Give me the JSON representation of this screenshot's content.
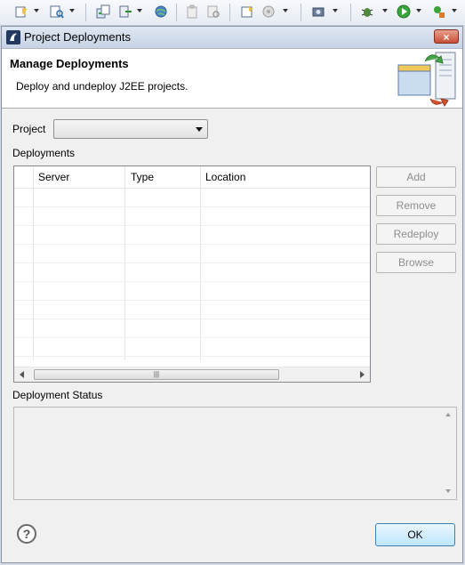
{
  "toolbar": {
    "icons": [
      "new-wizard-icon",
      "search-icon",
      "deploy-icon",
      "run-server-icon",
      "globe-icon",
      "clipboard-icon",
      "refresh-icon",
      "new-file-icon",
      "web-service-icon",
      "camera-icon",
      "debug-icon",
      "run-icon",
      "external-tools-icon"
    ]
  },
  "window": {
    "title": "Project Deployments",
    "close_label": "×"
  },
  "banner": {
    "title": "Manage Deployments",
    "description": "Deploy and undeploy J2EE projects."
  },
  "project": {
    "label": "Project",
    "value": ""
  },
  "deployments": {
    "label": "Deployments",
    "columns": [
      "Server",
      "Type",
      "Location"
    ],
    "rows": [],
    "scroll_thumb": "|||"
  },
  "buttons": {
    "add": "Add",
    "remove": "Remove",
    "redeploy": "Redeploy",
    "browse": "Browse",
    "ok": "OK",
    "help": "?"
  },
  "status": {
    "label": "Deployment Status",
    "text": ""
  },
  "colors": {
    "disabled_text": "#8d8d8d",
    "ok_border": "#3c7fb1",
    "close_red": "#c94e36"
  }
}
